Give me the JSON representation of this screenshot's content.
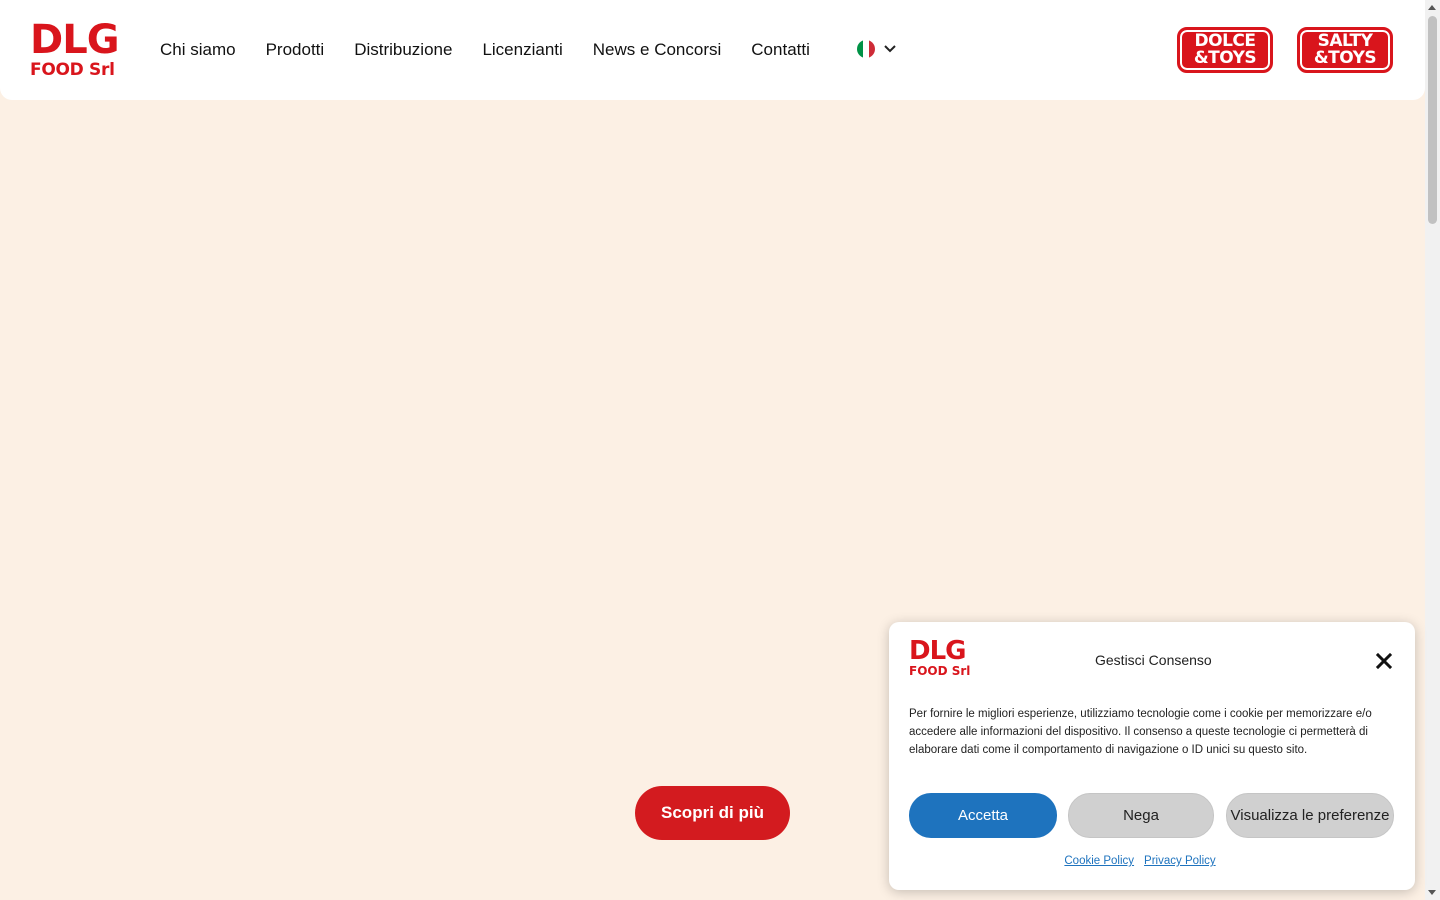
{
  "header": {
    "logo": {
      "line1": "DLG",
      "line2": "FOOD Srl"
    },
    "nav": [
      {
        "label": "Chi siamo"
      },
      {
        "label": "Prodotti"
      },
      {
        "label": "Distribuzione"
      },
      {
        "label": "Licenzianti"
      },
      {
        "label": "News e Concorsi"
      },
      {
        "label": "Contatti"
      }
    ],
    "language": {
      "flag_icon": "italian-flag-icon",
      "dropdown_icon": "chevron-down-icon"
    },
    "brands": [
      {
        "line1": "DOLCE",
        "line2": "&TOYS"
      },
      {
        "line1": "SALTY",
        "line2": "&TOYS"
      }
    ]
  },
  "hero": {
    "cta_label": "Scopri di più"
  },
  "cookie": {
    "logo": {
      "line1": "DLG",
      "line2": "FOOD Srl"
    },
    "title": "Gestisci Consenso",
    "text": "Per fornire le migliori esperienze, utilizziamo tecnologie come i cookie per memorizzare e/o accedere alle informazioni del dispositivo. Il consenso a queste tecnologie ci permetterà di elaborare dati come il comportamento di navigazione o ID unici su questo sito.",
    "accept_label": "Accetta",
    "deny_label": "Nega",
    "prefs_label": "Visualizza le preferenze",
    "cookie_policy_label": "Cookie Policy",
    "privacy_policy_label": "Privacy Policy"
  },
  "colors": {
    "brand_red": "#d9151c",
    "background": "#fcf0e4",
    "accept_blue": "#1e73be"
  }
}
